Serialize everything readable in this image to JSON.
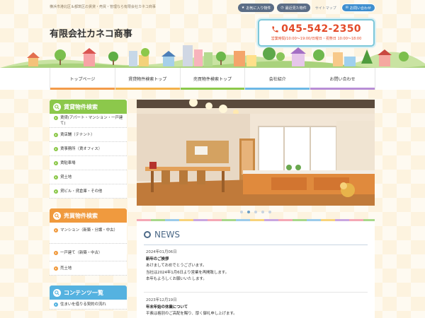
{
  "header": {
    "tagline": "横浜市港北区＆都筑区の賃貸・売買・管理なら有限会社カネコ商事",
    "favorites_label": "お気に入り物件",
    "recent_label": "最近見た物件",
    "sitemap_label": "サイトマップ",
    "contact_label": "お問い合わせ",
    "site_title": "有限会社カネコ商事",
    "phone": "045-542-2350",
    "hours": "営業時間/10:00～19:00/日曜日・祝祭日 10:00～18:00"
  },
  "nav": {
    "items": [
      {
        "label": "トップページ",
        "color": "#f39b4a"
      },
      {
        "label": "賃貸物件検索トップ",
        "color": "#f3b14a"
      },
      {
        "label": "売買物件検索トップ",
        "color": "#8cc84b"
      },
      {
        "label": "会社紹介",
        "color": "#6cb8e6"
      },
      {
        "label": "お問い合わせ",
        "color": "#b88ed6"
      }
    ]
  },
  "sidebar": {
    "rent": {
      "title": "賃貸物件検索",
      "color": "#8cc84b",
      "items": [
        "賃貸(アパート・マンション・一戸建て)",
        "賃店舗（テナント）",
        "賃事務所（賃オフィス）",
        "賃駐車場",
        "貸土地",
        "貸ビル・貸倉庫・その他"
      ]
    },
    "sale": {
      "title": "売買物件検索",
      "color": "#f09a3e",
      "items": [
        "マンション（新築・分譲・中古）",
        "一戸建て（新築・中古）",
        "売土地"
      ]
    },
    "contents": {
      "title": "コンテンツ一覧",
      "color": "#55b2e0",
      "items": [
        "住まいを借りる契約の流れ"
      ]
    }
  },
  "slider": {
    "dot_count": 5,
    "active_index": 1
  },
  "news": {
    "title": "NEWS",
    "entries": [
      {
        "date": "2024年01月06日",
        "title": "新年のご挨拶",
        "lines": [
          "あけましておめでとうございます。",
          "当社は2024年1月6日より営業を再開致します。",
          "本年もよろしくお願いいたします。"
        ]
      },
      {
        "date": "2023年12月19日",
        "title": "年末年始の休業について",
        "lines": [
          "平素は格別のご高配を賜り、厚く御礼申し上げます。"
        ]
      }
    ]
  }
}
